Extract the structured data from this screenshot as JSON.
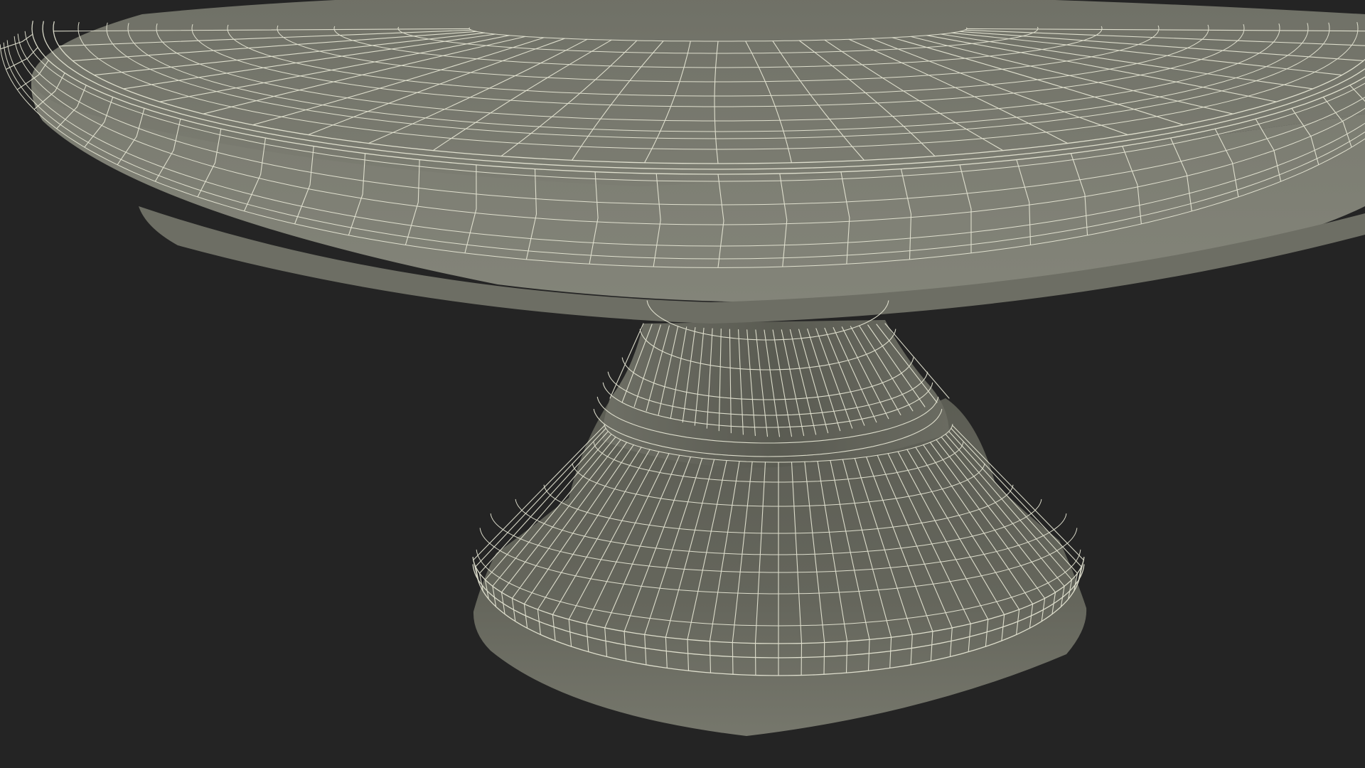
{
  "scene": {
    "subject": "cake-stand-wireframe",
    "colors": {
      "background": "#242424",
      "surface_light": "#7a7b70",
      "surface_mid": "#6b6c62",
      "surface_dark": "#595a51",
      "wire": "#e8e8d6"
    }
  }
}
